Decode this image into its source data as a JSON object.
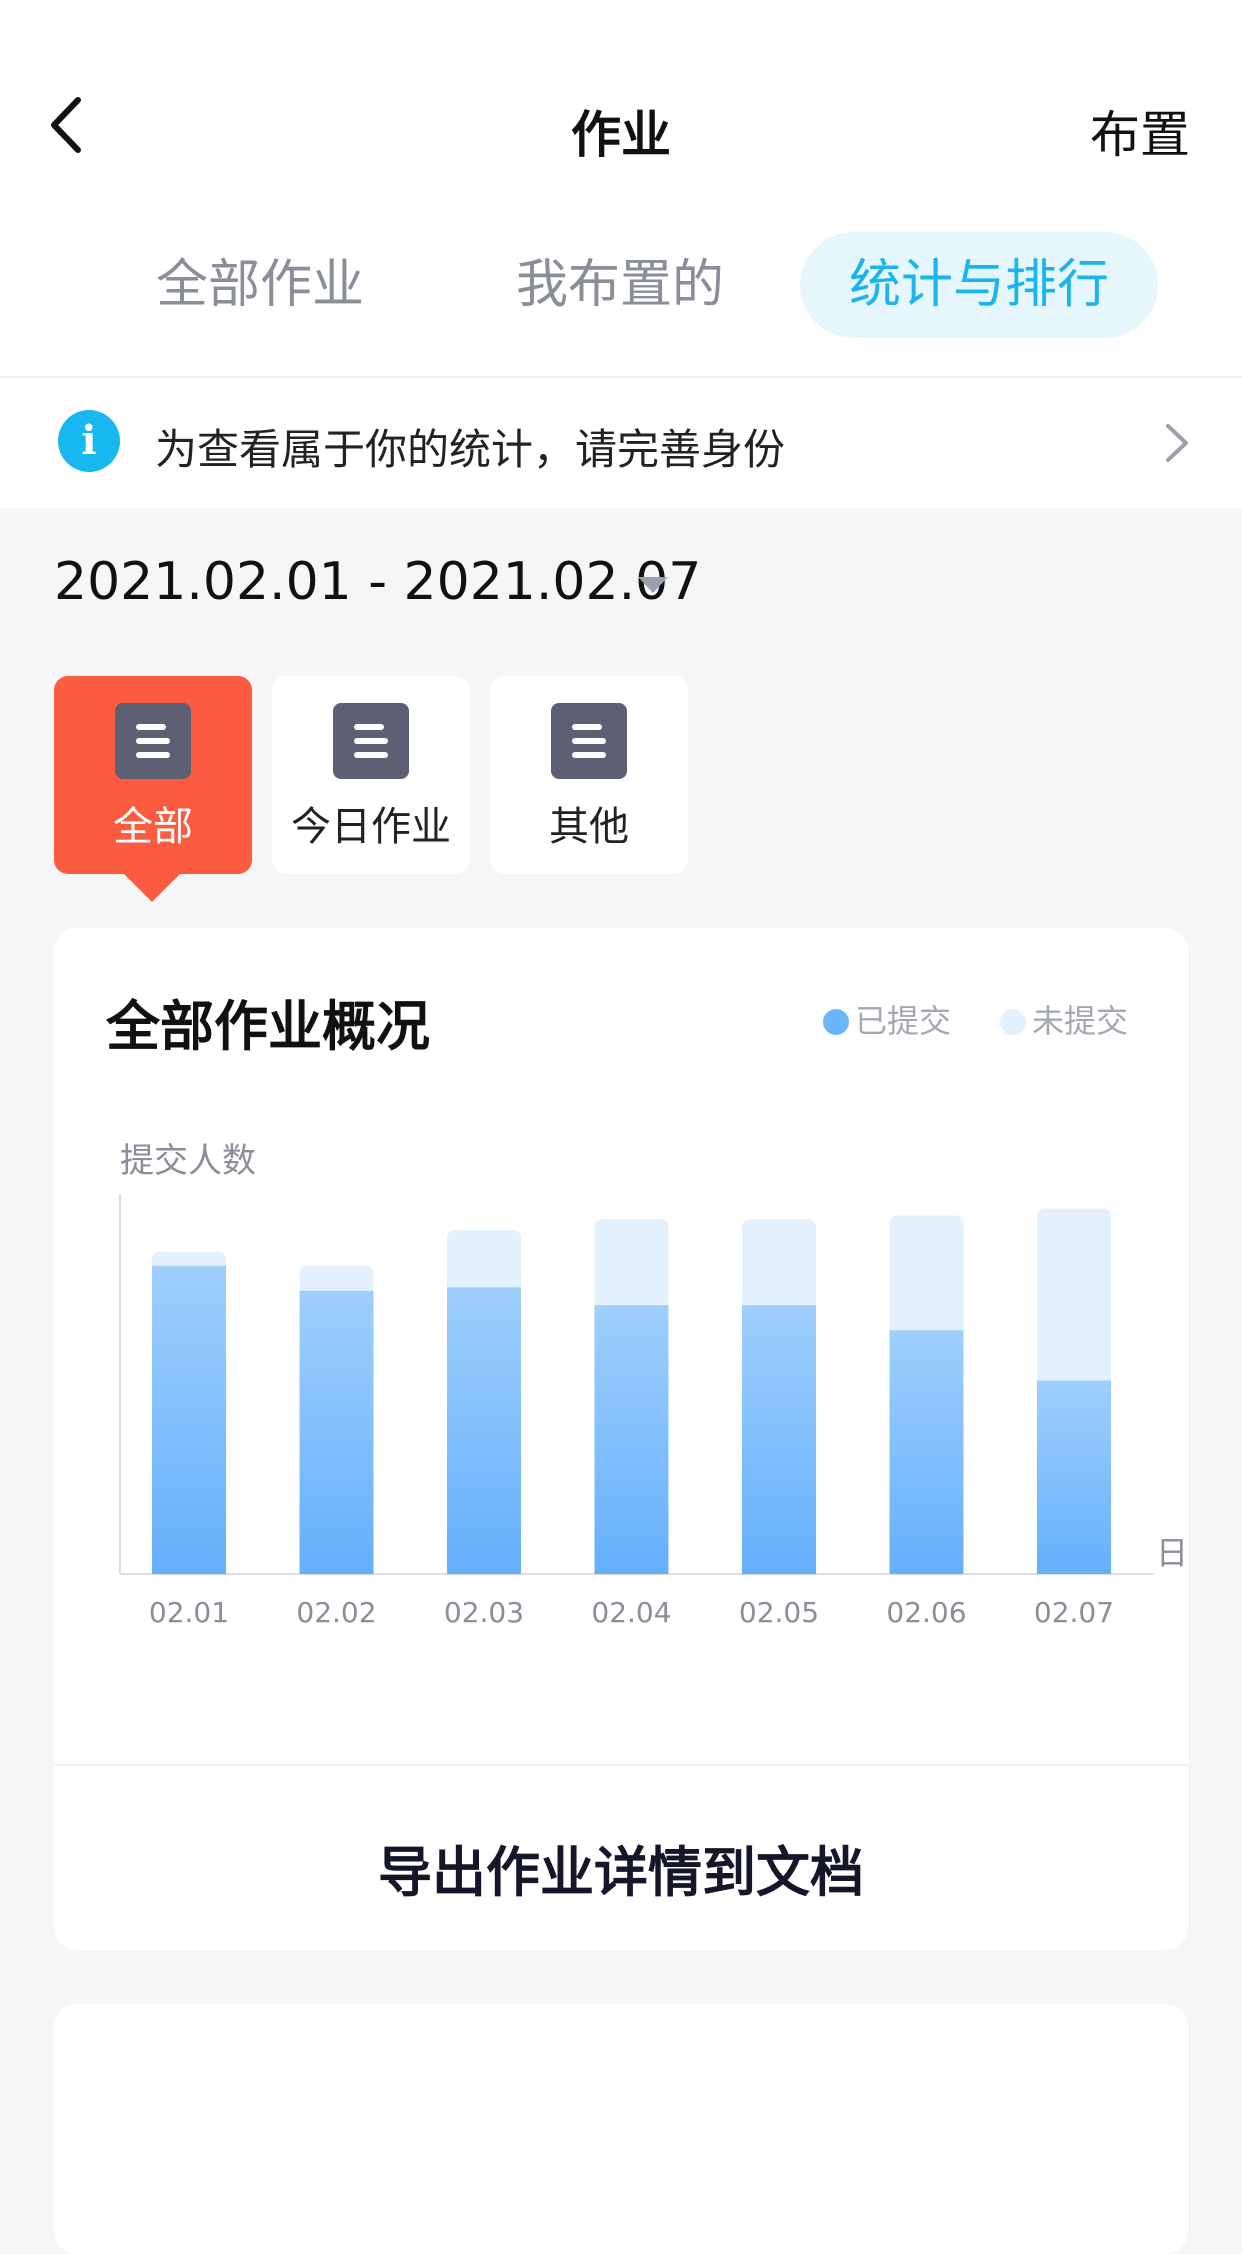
{
  "header": {
    "title": "作业",
    "assign_label": "布置"
  },
  "tabs": [
    {
      "label": "全部作业",
      "active": false
    },
    {
      "label": "我布置的",
      "active": false
    },
    {
      "label": "统计与排行",
      "active": true
    }
  ],
  "notice": {
    "icon": "info-icon",
    "text": "为查看属于你的统计，请完善身份"
  },
  "date_range": "2021.02.01 - 2021.02.07",
  "categories": [
    {
      "label": "全部",
      "icon": "document-icon",
      "active": true
    },
    {
      "label": "今日作业",
      "icon": "document-icon",
      "active": false
    },
    {
      "label": "其他",
      "icon": "document-icon",
      "active": false
    }
  ],
  "overview": {
    "title": "全部作业概况",
    "export_label": "导出作业详情到文档"
  },
  "colors": {
    "accent": "#fb5b3f",
    "tab_active": "#1bb5ec",
    "submitted": "#6bb5fb",
    "not_submitted": "#e3f1fd"
  },
  "chart_data": {
    "type": "bar",
    "stacked": true,
    "ylabel": "提交人数",
    "xlabel": "日",
    "categories": [
      "02.01",
      "02.02",
      "02.03",
      "02.04",
      "02.05",
      "02.06",
      "02.07"
    ],
    "series": [
      {
        "name": "已提交",
        "values": [
          86,
          79,
          80,
          75,
          75,
          68,
          54
        ]
      },
      {
        "name": "未提交",
        "values": [
          4,
          7,
          16,
          24,
          24,
          32,
          48
        ]
      }
    ],
    "ylim": [
      0,
      106
    ],
    "grid": false,
    "legend": "top-right"
  }
}
